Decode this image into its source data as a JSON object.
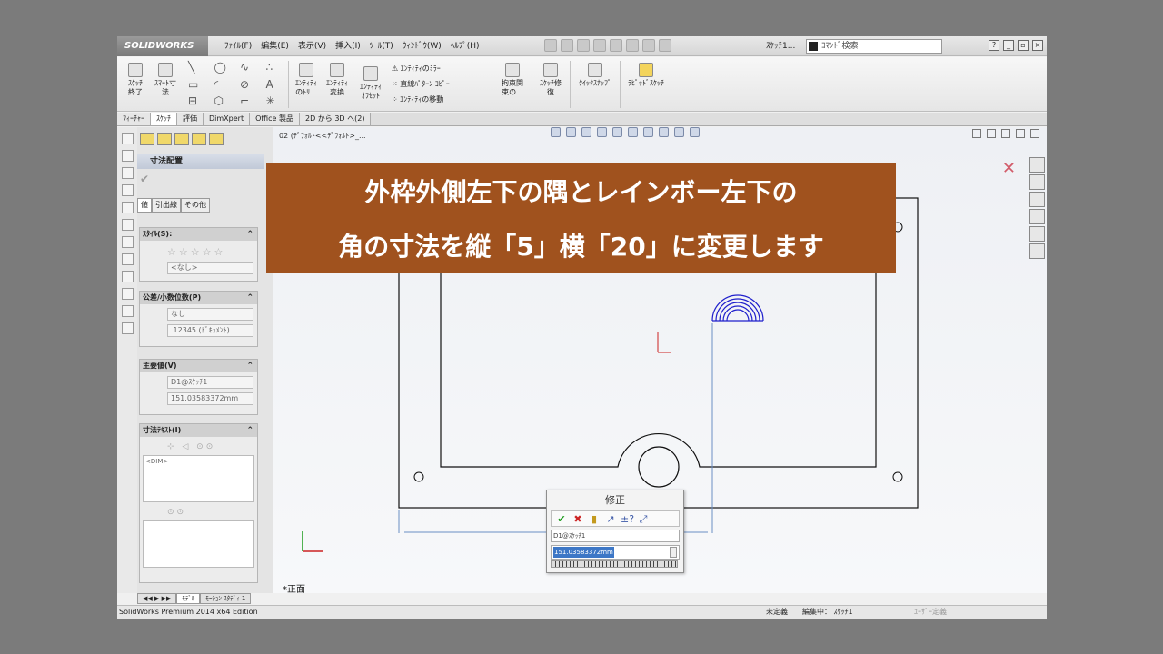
{
  "app": {
    "logo": "SOLIDWORKS",
    "menu": [
      "ﾌｧｲﾙ(F)",
      "編集(E)",
      "表示(V)",
      "挿入(I)",
      "ﾂｰﾙ(T)",
      "ｳｨﾝﾄﾞｳ(W)",
      "ﾍﾙﾌﾟ(H)"
    ],
    "doc_name": "ｽｹｯﾁ1...",
    "search_placeholder": "ｺﾏﾝﾄﾞ検索"
  },
  "ribbon": {
    "exit_sketch": "ｽｹｯﾁ\n終了",
    "smart_dim": "ｽﾏｰﾄ寸\n法",
    "trim": "ｴﾝﾃｨﾃｨ\nのﾄﾘ...",
    "convert": "ｴﾝﾃｨﾃｨ\n変換",
    "offset": "ｴﾝﾃｨﾃｨ\nｵﾌｾｯﾄ",
    "mirror": "ｴﾝﾃｨﾃｨのﾐﾗｰ",
    "linear_pattern": "直線ﾊﾟﾀｰﾝ ｺﾋﾟｰ",
    "move": "ｴﾝﾃｨﾃｨの移動",
    "relations": "拘束関\n束の...",
    "repair": "ｽｹｯﾁ修\n復",
    "quick_snaps": "ｸｲｯｸｽﾅｯﾌﾟ",
    "rapid_sketch": "ﾗﾋﾟｯﾄﾞｽｹｯﾁ"
  },
  "tabs": [
    "ﾌｨｰﾁｬｰ",
    "ｽｹｯﾁ",
    "評価",
    "DimXpert",
    "Office 製品",
    "2D から 3D へ(2)"
  ],
  "tree": {
    "item": "02 (ﾃﾞﾌｫﾙﾄ<<ﾃﾞﾌｫﾙﾄ>_..."
  },
  "property_manager": {
    "title": "寸法配置",
    "tabs": [
      "値",
      "引出線",
      "その他"
    ],
    "style_header": "ｽﾀｲﾙ(S):",
    "style_value": "<なし>",
    "tolerance_header": "公差/小数位数(P)",
    "tolerance_value": "なし",
    "precision_value": ".12345 (ﾄﾞｷｭﾒﾝﾄ)",
    "primary_header": "主要値(V)",
    "dim_name": "D1@ｽｹｯﾁ1",
    "dim_value": "151.03583372mm",
    "text_header": "寸法ﾃｷｽﾄ(I)",
    "text_placeholder": "<DIM>"
  },
  "bottom_tabs": [
    "ﾓﾃﾞﾙ",
    "ﾓｰｼｮﾝ ｽﾀﾃﾞｨ 1"
  ],
  "status": {
    "app": "SolidWorks Premium 2014 x64 Edition",
    "defined": "未定義",
    "editing": "編集中： ｽｹｯﾁ1",
    "units": "ﾕｰｻﾞｰ定義"
  },
  "caption": {
    "line1": "外枠外側左下の隅とレインボー左下の",
    "line2": "角の寸法を縦「5」横「20」に変更します"
  },
  "modify": {
    "title": "修正",
    "dim_name": "D1@ｽｹｯﾁ1",
    "value": "151.03583372mm"
  },
  "view_label": "*正面"
}
